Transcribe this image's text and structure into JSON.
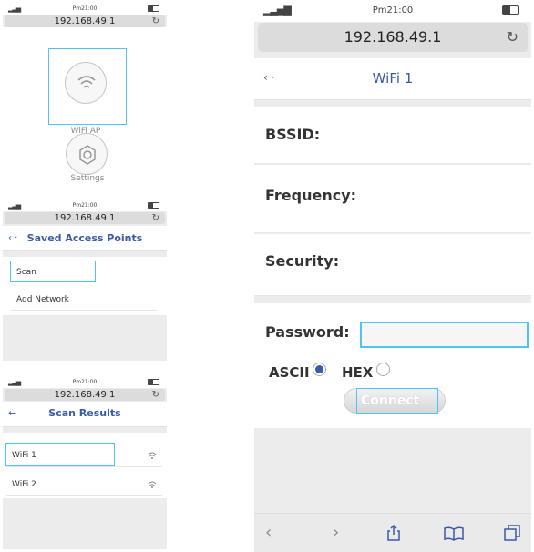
{
  "common": {
    "time": "Pm21:00",
    "address": "192.168.49.1",
    "reload_icon": "↻"
  },
  "screen1": {
    "wifi_ap_label": "WiFi AP",
    "settings_label": "Settings"
  },
  "screen2": {
    "back": "‹ ·",
    "title": "Saved Access Points",
    "items": [
      "Scan",
      "Add Network"
    ]
  },
  "screen3": {
    "back": "←",
    "title": "Scan Results",
    "items": [
      "WiFi 1",
      "WiFi 2"
    ]
  },
  "detail": {
    "back": "‹ ·",
    "title": "WiFi 1",
    "bssid_label": "BSSID:",
    "frequency_label": "Frequency:",
    "security_label": "Security:",
    "password_label": "Password:",
    "password_value": "",
    "ascii_label": "ASCII",
    "hex_label": "HEX",
    "connect_label": "Connect",
    "selected_encoding": "ascii"
  },
  "colors": {
    "accent": "#3a5aa8",
    "highlight": "#4fc3f7"
  }
}
